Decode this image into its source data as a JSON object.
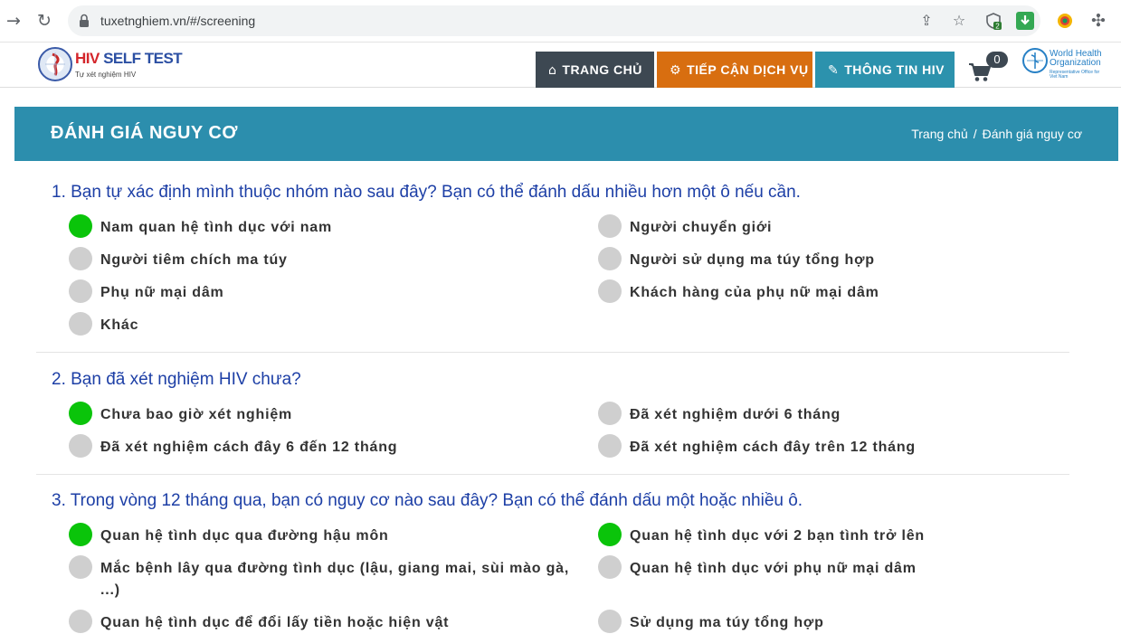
{
  "browser": {
    "url": "tuxetnghiem.vn/#/screening",
    "extension_badge": "2"
  },
  "header": {
    "logo_title_hiv": "HIV",
    "logo_title_rest": "SELF TEST",
    "logo_subtitle": "Tự xét nghiệm HIV",
    "menu": [
      {
        "label": "TRANG CHỦ",
        "icon": "home-icon",
        "color": "#3d4852"
      },
      {
        "label": "TIẾP CẬN DỊCH VỤ",
        "icon": "cogs-icon",
        "color": "#d86e10"
      },
      {
        "label": "THÔNG TIN HIV",
        "icon": "magic-icon",
        "color": "#2c92ad"
      }
    ],
    "cart_count": "0",
    "who_name": "World Health Organization",
    "who_office": "Representative Office for Viet Nam"
  },
  "banner": {
    "title": "ĐÁNH GIÁ NGUY CƠ",
    "breadcrumb_home": "Trang chủ",
    "breadcrumb_sep": "/",
    "breadcrumb_current": "Đánh giá nguy cơ",
    "color": "#2c8ead"
  },
  "questions": [
    {
      "text": "1. Bạn tự xác định mình thuộc nhóm nào sau đây? Bạn có thể đánh dấu nhiều hơn một ô nếu cần.",
      "options": [
        {
          "label": "Nam quan hệ tình dục với nam",
          "checked": true
        },
        {
          "label": "Người chuyển giới",
          "checked": false
        },
        {
          "label": "Người tiêm chích ma túy",
          "checked": false
        },
        {
          "label": "Người sử dụng ma túy tổng hợp",
          "checked": false
        },
        {
          "label": "Phụ nữ mại dâm",
          "checked": false
        },
        {
          "label": "Khách hàng của phụ nữ mại dâm",
          "checked": false
        },
        {
          "label": "Khác",
          "checked": false
        }
      ]
    },
    {
      "text": "2. Bạn đã xét nghiệm HIV chưa?",
      "options": [
        {
          "label": "Chưa bao giờ xét nghiệm",
          "checked": true
        },
        {
          "label": "Đã xét nghiệm dưới 6 tháng",
          "checked": false
        },
        {
          "label": "Đã xét nghiệm cách đây 6 đến 12 tháng",
          "checked": false
        },
        {
          "label": "Đã xét nghiệm cách đây trên 12 tháng",
          "checked": false
        }
      ]
    },
    {
      "text": "3. Trong vòng 12 tháng qua, bạn có nguy cơ nào sau đây? Bạn có thể đánh dấu một hoặc nhiều ô.",
      "options": [
        {
          "label": "Quan hệ tình dục qua đường hậu môn",
          "checked": true
        },
        {
          "label": "Quan hệ tình dục với 2 bạn tình trở lên",
          "checked": true
        },
        {
          "label": "Mắc bệnh lây qua đường tình dục (lậu, giang mai, sùi mào gà, ...)",
          "checked": false
        },
        {
          "label": "Quan hệ tình dục với phụ nữ mại dâm",
          "checked": false
        },
        {
          "label": "Quan hệ tình dục để đổi lấy tiền hoặc hiện vật",
          "checked": false
        },
        {
          "label": "Sử dụng ma túy tổng hợp",
          "checked": false
        }
      ]
    }
  ]
}
